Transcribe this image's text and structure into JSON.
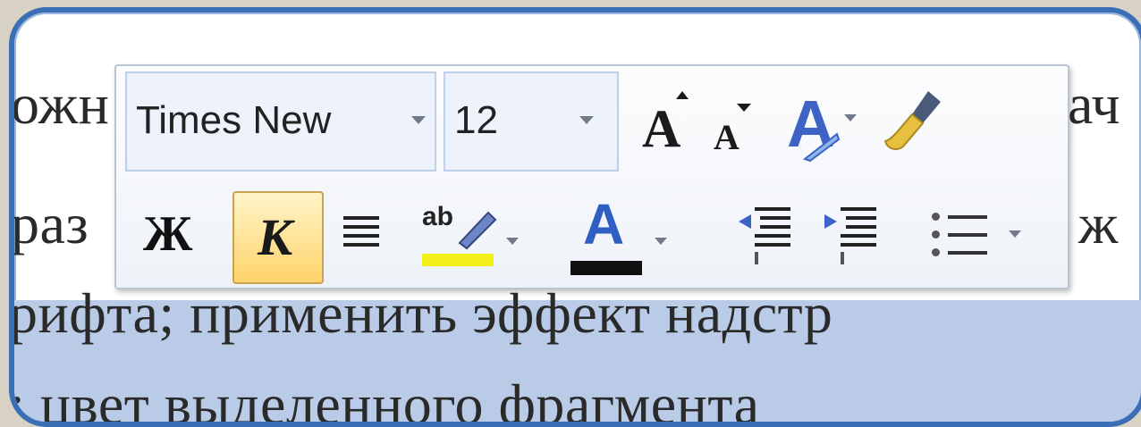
{
  "document": {
    "line1_left": "ожн",
    "line1_right": "ач",
    "line2_left": "раз",
    "line2_right": "ж",
    "line3": "рифта; применить эффект надстр",
    "line4": "; цвет выделенного фрагмента"
  },
  "toolbar": {
    "font_name": "Times New",
    "font_size": "12",
    "grow_font_label": "A",
    "shrink_font_label": "A",
    "styles_label": "A",
    "bold_label": "Ж",
    "italic_label": "К",
    "highlight_label": "ab",
    "font_color_label": "A",
    "icons": {
      "brush": "format-painter-icon",
      "align": "center-align-icon",
      "indent_decrease": "decrease-indent-icon",
      "indent_increase": "increase-indent-icon",
      "list": "bullet-list-icon"
    },
    "colors": {
      "highlight": "#f3ef18",
      "font_color": "#101010",
      "italic_active": "#ffd36a"
    }
  }
}
